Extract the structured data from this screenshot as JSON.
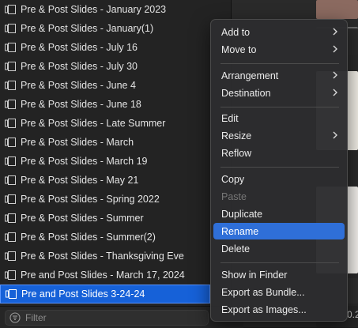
{
  "list": {
    "items": [
      "Pre & Post Slides - January 2023",
      "Pre & Post Slides - January(1)",
      "Pre & Post Slides - July 16",
      "Pre & Post Slides - July 30",
      "Pre & Post Slides - June 4",
      "Pre & Post Slides - June 18",
      "Pre & Post Slides - Late Summer",
      "Pre & Post Slides - March",
      "Pre & Post Slides - March 19",
      "Pre & Post Slides - May 21",
      "Pre & Post Slides - Spring 2022",
      "Pre & Post Slides - Summer",
      "Pre & Post Slides - Summer(2)",
      "Pre & Post Slides - Thanksgiving Eve",
      "Pre and Post Slides - March 17, 2024",
      "Pre and Post Slides 3-24-24"
    ],
    "selected_index": 15
  },
  "filter": {
    "placeholder": "Filter"
  },
  "preview": {
    "number": "0.2"
  },
  "menu": {
    "items": [
      {
        "label": "Add to",
        "submenu": true
      },
      {
        "label": "Move to",
        "submenu": true
      },
      {
        "label": "Arrangement",
        "submenu": true
      },
      {
        "label": "Destination",
        "submenu": true
      },
      {
        "label": "Edit",
        "submenu": false
      },
      {
        "label": "Resize",
        "submenu": true
      },
      {
        "label": "Reflow",
        "submenu": false
      },
      {
        "label": "Copy",
        "submenu": false
      },
      {
        "label": "Paste",
        "submenu": false,
        "disabled": true
      },
      {
        "label": "Duplicate",
        "submenu": false
      },
      {
        "label": "Rename",
        "submenu": false,
        "highlighted": true
      },
      {
        "label": "Delete",
        "submenu": false
      },
      {
        "label": "Show in Finder",
        "submenu": false
      },
      {
        "label": "Export as Bundle...",
        "submenu": false
      },
      {
        "label": "Export as Images...",
        "submenu": false
      }
    ]
  },
  "colors": {
    "selection": "#1661d8",
    "menu_highlight": "#2f6fd8"
  }
}
